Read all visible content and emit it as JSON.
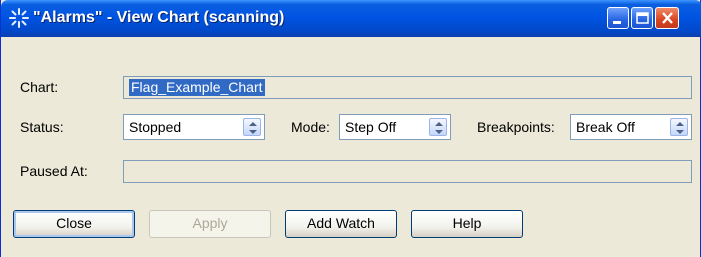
{
  "window": {
    "title": "\"Alarms\" - View Chart (scanning)",
    "colors": {
      "titlebar": "#0054e3",
      "body": "#ece9d8",
      "selection": "#316ac5"
    }
  },
  "labels": {
    "chart": "Chart:",
    "status": "Status:",
    "mode": "Mode:",
    "breakpoints": "Breakpoints:",
    "paused_at": "Paused At:"
  },
  "fields": {
    "chart_value": "Flag_Example_Chart",
    "status_value": "Stopped",
    "mode_value": "Step Off",
    "breakpoints_value": "Break Off",
    "paused_at_value": ""
  },
  "buttons": {
    "close": "Close",
    "apply": "Apply",
    "add_watch": "Add Watch",
    "help": "Help"
  },
  "icons": {
    "title": "sparkle-icon",
    "minimize": "minimize-icon",
    "maximize": "maximize-icon",
    "close": "close-icon",
    "spinner": "spinner-arrows-icon"
  }
}
